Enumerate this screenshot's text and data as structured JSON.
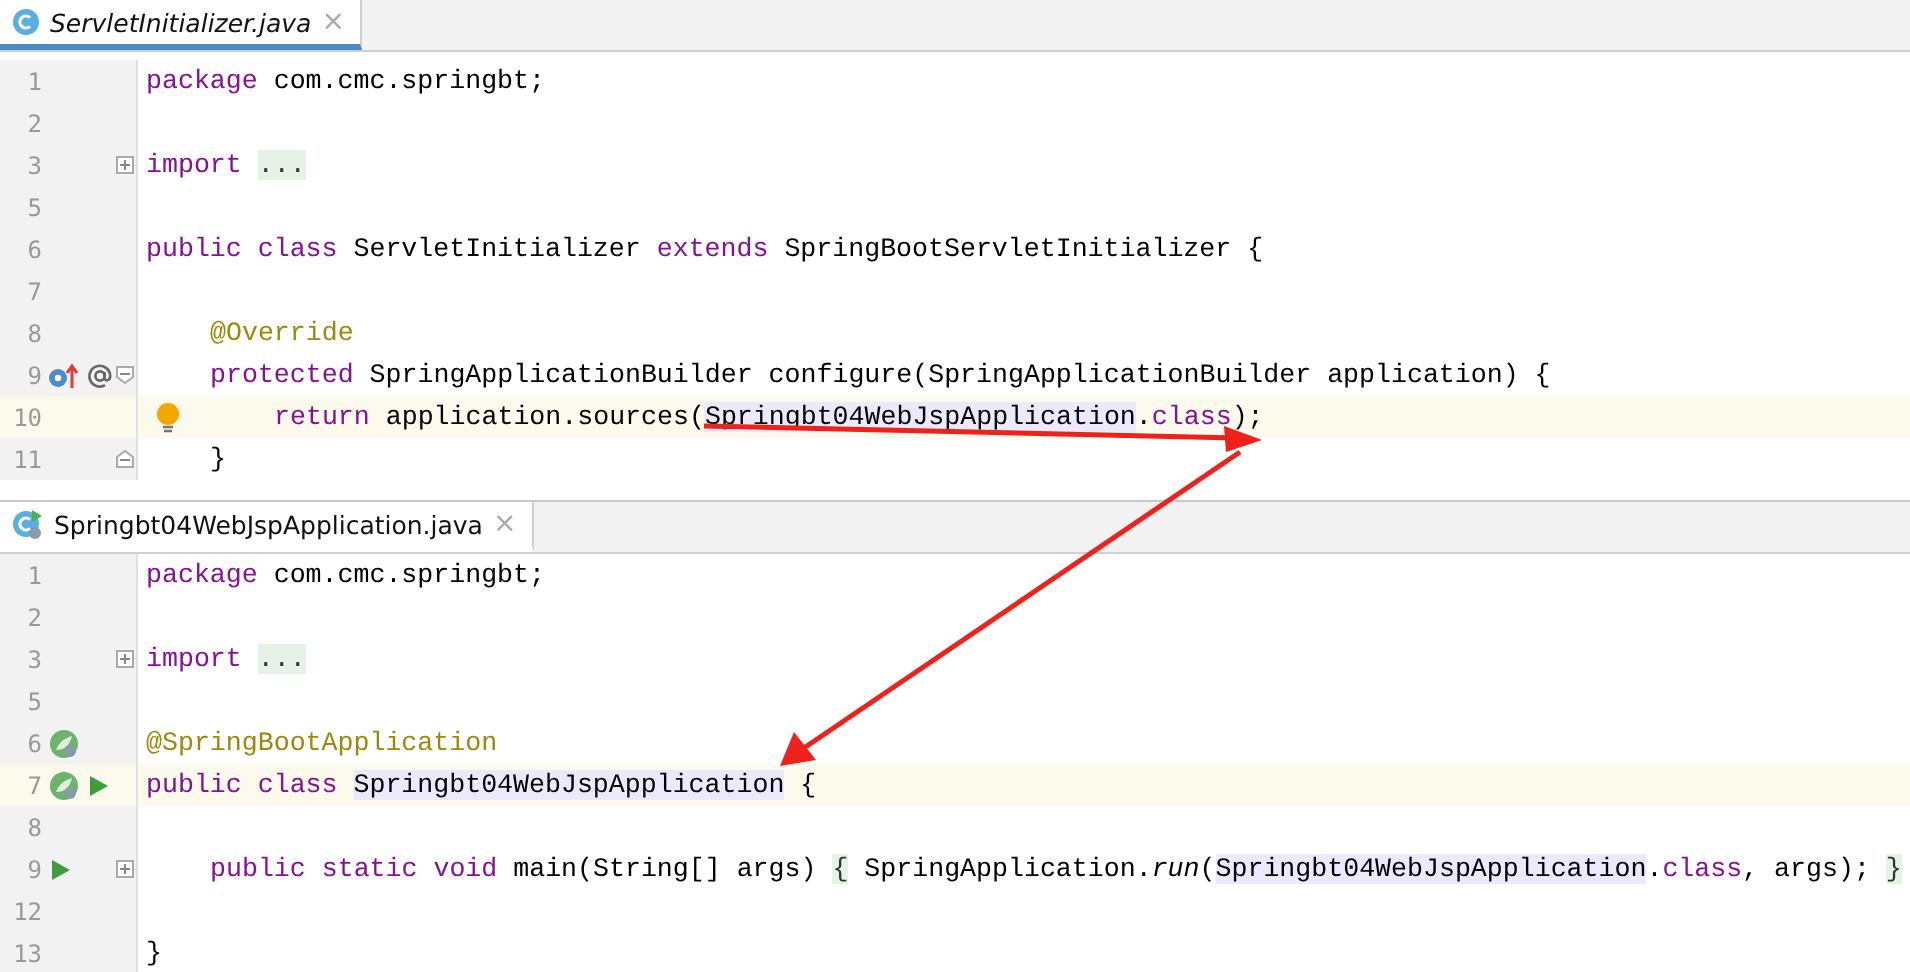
{
  "panes": [
    {
      "tab": {
        "label": "ServletInitializer.java",
        "kind": "class",
        "italic": true,
        "selected": true,
        "close": "×"
      },
      "lines": [
        {
          "number": "1",
          "current": false,
          "kind": "top",
          "tokens": [
            {
              "kind": "keyword",
              "text": "package"
            },
            {
              "kind": "plain",
              "text": " com.cmc.springbt;"
            }
          ]
        },
        {
          "number": "2",
          "current": false
        },
        {
          "number": "3",
          "current": false,
          "kind": "top",
          "fold_marker": {
            "kind": "start",
            "expanded": false
          },
          "tokens": [
            {
              "kind": "keyword",
              "text": "import "
            },
            {
              "kind": "folded",
              "text": "..."
            }
          ]
        },
        {
          "number": "5",
          "current": false
        },
        {
          "number": "6",
          "current": false,
          "kind": "top",
          "tokens": [
            {
              "kind": "keyword",
              "text": "public class"
            },
            {
              "kind": "plain",
              "text": " ServletInitializer "
            },
            {
              "kind": "keyword",
              "text": "extends"
            },
            {
              "kind": "plain",
              "text": " SpringBootServletInitializer {"
            }
          ]
        },
        {
          "number": "7",
          "current": false
        },
        {
          "number": "8",
          "current": false,
          "kind": "member",
          "tokens": [
            {
              "kind": "annotation",
              "text": "@Override"
            }
          ]
        },
        {
          "number": "9",
          "current": false,
          "kind": "member",
          "fold_marker": {
            "kind": "start",
            "expanded": true
          },
          "gutter": [
            {
              "kind": "overrides"
            },
            {
              "kind": "at"
            }
          ],
          "tokens": [
            {
              "kind": "keyword",
              "text": "protected"
            },
            {
              "kind": "plain",
              "text": " SpringApplicationBuilder configure(SpringApplicationBuilder application) {"
            }
          ]
        },
        {
          "number": "10",
          "current": true,
          "kind": "body",
          "bulb": true,
          "tokens": [
            {
              "kind": "keyword",
              "text": "return"
            },
            {
              "kind": "plain",
              "text": " application.sources("
            },
            {
              "kind": "usage",
              "text": "Springbt04WebJspApplication"
            },
            {
              "kind": "plain",
              "text": "."
            },
            {
              "kind": "keyword",
              "text": "class"
            },
            {
              "kind": "plain",
              "text": ");"
            }
          ]
        },
        {
          "number": "11",
          "current": false,
          "kind": "member",
          "fold_marker": {
            "kind": "end",
            "expanded": true
          },
          "tokens": [
            {
              "kind": "plain",
              "text": "}"
            }
          ]
        }
      ]
    },
    {
      "tab": {
        "label": "Springbt04WebJspApplication.java",
        "kind": "spring-class",
        "italic": false,
        "selected": false,
        "close": "×"
      },
      "lines": [
        {
          "number": "1",
          "current": false,
          "kind": "top",
          "tokens": [
            {
              "kind": "keyword",
              "text": "package"
            },
            {
              "kind": "plain",
              "text": " com.cmc.springbt;"
            }
          ]
        },
        {
          "number": "2",
          "current": false
        },
        {
          "number": "3",
          "current": false,
          "kind": "top",
          "fold_marker": {
            "kind": "start",
            "expanded": false
          },
          "tokens": [
            {
              "kind": "keyword",
              "text": "import "
            },
            {
              "kind": "folded",
              "text": "..."
            }
          ]
        },
        {
          "number": "5",
          "current": false
        },
        {
          "number": "6",
          "current": false,
          "kind": "top",
          "gutter": [
            {
              "kind": "bean"
            }
          ],
          "tokens": [
            {
              "kind": "annotation",
              "text": "@SpringBootApplication"
            }
          ]
        },
        {
          "number": "7",
          "current": true,
          "kind": "top",
          "gutter": [
            {
              "kind": "bean"
            },
            {
              "kind": "run"
            }
          ],
          "tokens": [
            {
              "kind": "keyword",
              "text": "public class "
            },
            {
              "kind": "usage",
              "text": "Springbt04WebJspApplication"
            },
            {
              "kind": "plain",
              "text": " {"
            }
          ]
        },
        {
          "number": "8",
          "current": false
        },
        {
          "number": "9",
          "current": false,
          "kind": "member",
          "fold_marker": {
            "kind": "start",
            "expanded": false
          },
          "gutter": [
            {
              "kind": "run"
            }
          ],
          "tokens": [
            {
              "kind": "keyword",
              "text": "public static void"
            },
            {
              "kind": "plain",
              "text": " main(String[] args) "
            },
            {
              "kind": "folded",
              "text": "{"
            },
            {
              "kind": "plain",
              "text": " SpringApplication."
            },
            {
              "kind": "italic",
              "text": "run"
            },
            {
              "kind": "plain",
              "text": "("
            },
            {
              "kind": "usage",
              "text": "Springbt04WebJspApplication"
            },
            {
              "kind": "plain",
              "text": "."
            },
            {
              "kind": "keyword",
              "text": "class"
            },
            {
              "kind": "plain",
              "text": ", args); "
            },
            {
              "kind": "folded",
              "text": "}"
            }
          ]
        },
        {
          "number": "12",
          "current": false
        },
        {
          "number": "13",
          "current": false,
          "kind": "top",
          "tokens": [
            {
              "kind": "plain",
              "text": "}"
            }
          ]
        }
      ]
    }
  ]
}
